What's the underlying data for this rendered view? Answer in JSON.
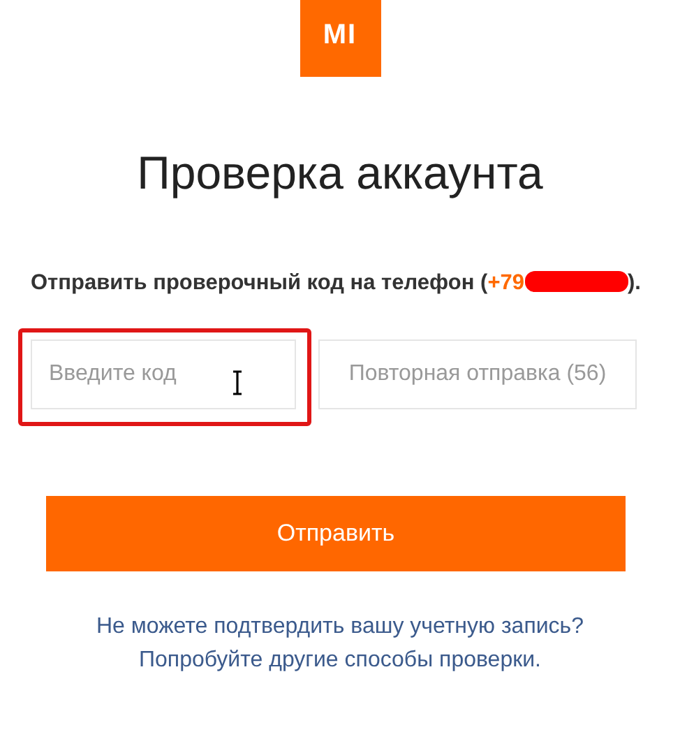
{
  "logo": {
    "text": "MI"
  },
  "title": "Проверка аккаунта",
  "message": {
    "text": "Отправить проверочный код на телефон",
    "open": "(",
    "phone": "+79",
    "phone_redacted": true,
    "close": ")."
  },
  "code_field": {
    "placeholder": "Введите код",
    "highlighted": true,
    "mouse_cursor": true
  },
  "resend_button": {
    "label": "Повторная отправка (56)",
    "disabled": true
  },
  "submit_button": {
    "label": "Отправить"
  },
  "help_links": [
    "Не можете подтвердить вашу учетную запись?",
    "Попробуйте другие способы проверки."
  ]
}
